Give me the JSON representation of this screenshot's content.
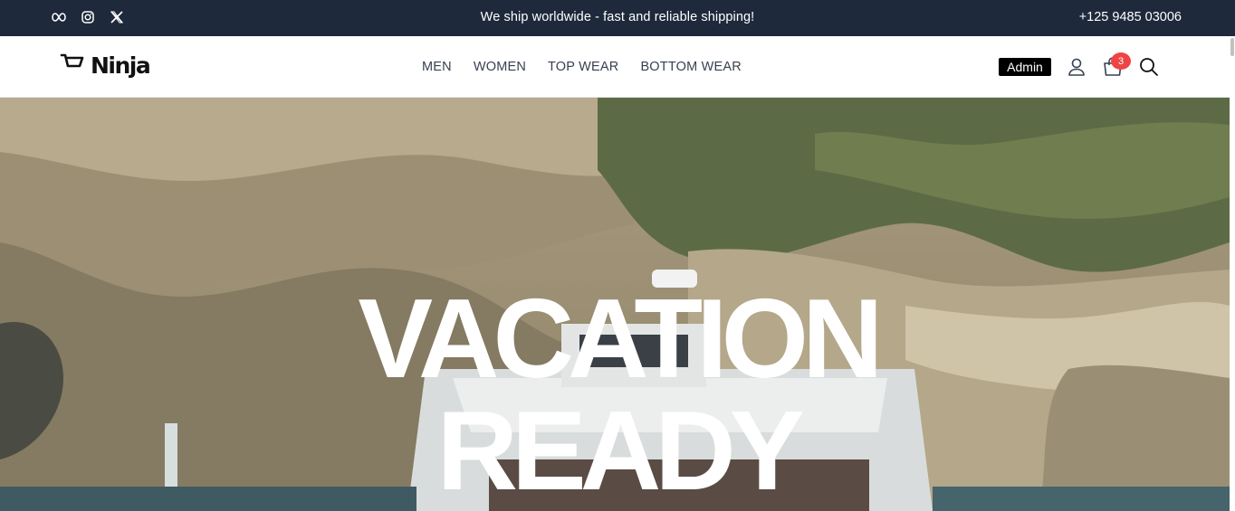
{
  "topbar": {
    "social": [
      {
        "name": "meta-icon"
      },
      {
        "name": "instagram-icon"
      },
      {
        "name": "x-icon"
      }
    ],
    "announcement": "We ship worldwide - fast and reliable shipping!",
    "phone": "+125 9485 03006"
  },
  "header": {
    "logo_text": "Ninja",
    "nav": [
      {
        "label": "MEN"
      },
      {
        "label": "WOMEN"
      },
      {
        "label": "TOP WEAR"
      },
      {
        "label": "BOTTOM WEAR"
      }
    ],
    "admin_label": "Admin",
    "cart_count": "3"
  },
  "hero": {
    "line1": "VACATION",
    "line2": "READY"
  },
  "colors": {
    "topbar_bg": "#1e293b",
    "badge": "#ef4444",
    "admin_bg": "#000000"
  }
}
